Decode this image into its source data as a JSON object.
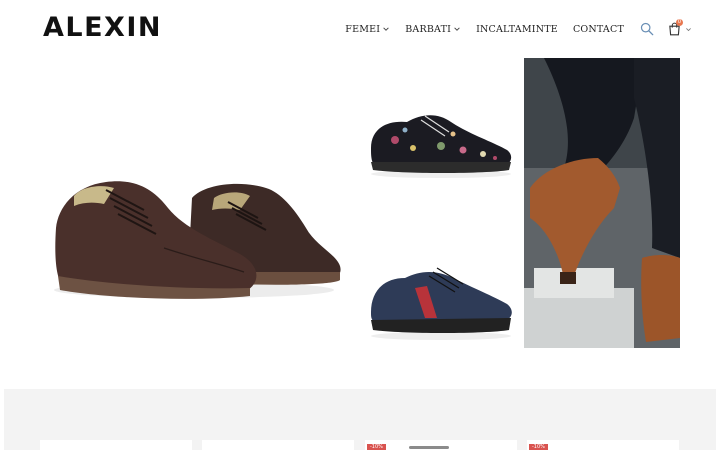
{
  "header": {
    "logo": "ALEXIN",
    "nav": [
      {
        "label": "FEMEI",
        "has_dropdown": true
      },
      {
        "label": "BARBATI",
        "has_dropdown": true
      },
      {
        "label": "INCALTAMINTE",
        "has_dropdown": false
      },
      {
        "label": "CONTACT",
        "has_dropdown": false
      }
    ],
    "search_icon": "search-icon",
    "cart": {
      "icon": "shopping-bag-icon",
      "count": "0",
      "badge_color": "#e8774f"
    }
  },
  "hero": {
    "tiles": [
      {
        "name": "men-brown-brogue-shoes",
        "subject": "brown leather derby shoes"
      },
      {
        "name": "women-floral-oxford-shoe",
        "subject": "black floral patent oxford"
      },
      {
        "name": "men-navy-sneaker",
        "subject": "navy sneaker with red stripe"
      },
      {
        "name": "women-brown-ankle-boots",
        "subject": "brown leather ankle boots"
      }
    ]
  },
  "products": {
    "background": "#f3f3f3",
    "cards": [
      {
        "sale_badge": ""
      },
      {
        "sale_badge": ""
      },
      {
        "sale_badge": "-10%"
      },
      {
        "sale_badge": "-10%"
      }
    ]
  }
}
